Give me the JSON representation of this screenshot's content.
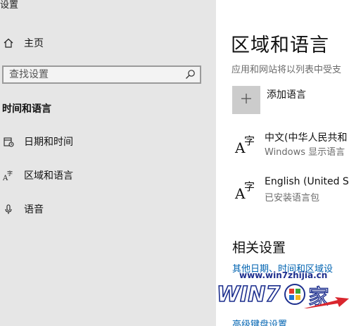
{
  "app": {
    "title": "设置"
  },
  "sidebar": {
    "home_label": "主页",
    "search_placeholder": "查找设置",
    "section_heading": "时间和语言",
    "items": [
      {
        "label": "日期和时间",
        "icon": "calendar-clock-icon"
      },
      {
        "label": "区域和语言",
        "icon": "language-icon"
      },
      {
        "label": "语音",
        "icon": "microphone-icon"
      }
    ]
  },
  "main": {
    "title": "区域和语言",
    "description": "应用和网站将以列表中受支",
    "add_language_label": "添加语言",
    "languages": [
      {
        "name": "中文(中华人民共和",
        "status": "Windows 显示语言"
      },
      {
        "name": "English (United Sta",
        "status": "已安装语言包"
      }
    ],
    "related_settings_title": "相关设置",
    "links": [
      "其他日期、时间和区域设",
      "高级键盘设置"
    ]
  },
  "watermark": {
    "url": "www.win7zhijia.cn",
    "brand": "WIN7",
    "brand_suffix": "家"
  }
}
